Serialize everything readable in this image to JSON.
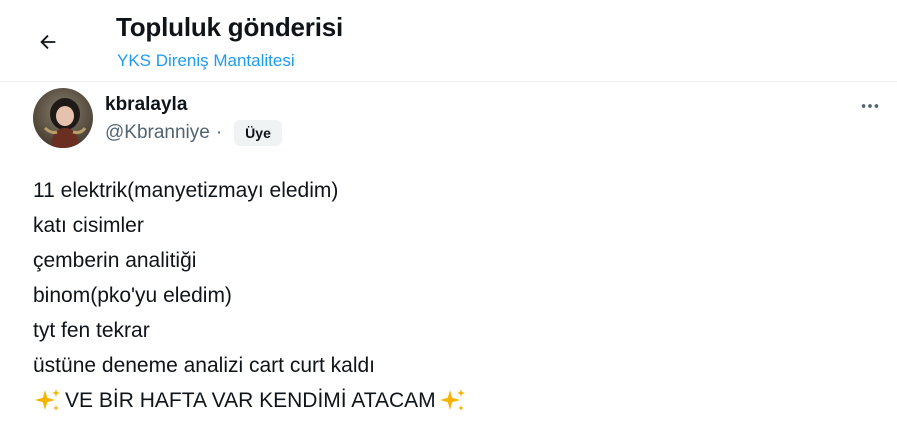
{
  "header": {
    "title": "Topluluk gönderisi",
    "community_name": "YKS Direniş Mantalitesi",
    "back_icon": "arrow-left-icon"
  },
  "post": {
    "author": {
      "display_name": "kbralayla",
      "handle": "@Kbranniye",
      "separator": "·",
      "badge": "Üye",
      "avatar_icon": "user-avatar"
    },
    "more_icon": "more-horizontal-icon",
    "lines": [
      "11 elektrik(manyetizmayı eledim)",
      "katı cisimler",
      "çemberin analitiği",
      "binom(pko'yu eledim)",
      "tyt fen tekrar",
      "üstüne deneme analizi cart curt kaldı"
    ],
    "final_line": "VE BİR HAFTA VAR KENDİMİ ATACAM",
    "final_line_emoji": "sparkles-icon"
  },
  "colors": {
    "accent": "#1d9bf0",
    "text_primary": "#0f1419",
    "text_secondary": "#536471",
    "badge_bg": "#eff3f4",
    "sparkle": "#f4b400"
  }
}
